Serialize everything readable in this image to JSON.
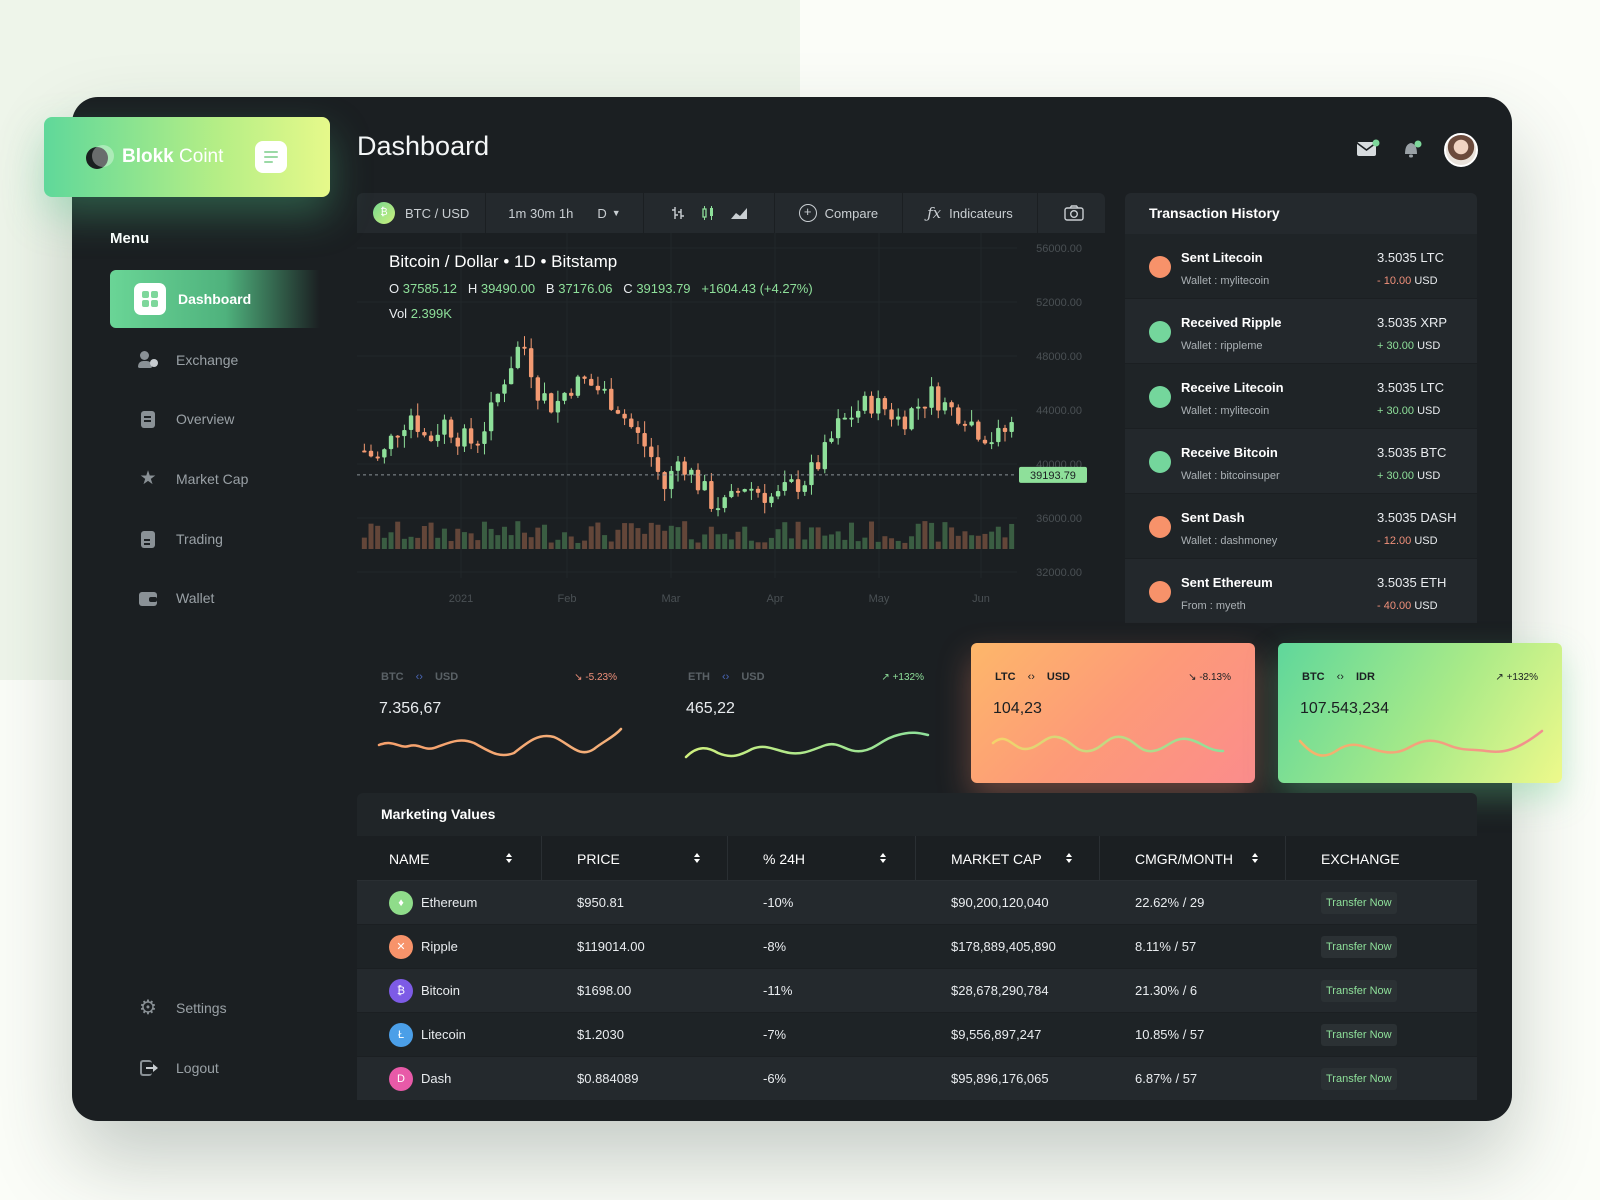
{
  "brand": {
    "name_bold": "Blokk",
    "name_light": "Coint"
  },
  "sidebar": {
    "menu_title": "Menu",
    "items": [
      {
        "label": "Dashboard",
        "icon": "grid-icon",
        "active": true
      },
      {
        "label": "Exchange",
        "icon": "users-icon"
      },
      {
        "label": "Overview",
        "icon": "document-icon"
      },
      {
        "label": "Market Cap",
        "icon": "star-icon"
      },
      {
        "label": "Trading",
        "icon": "file-icon"
      },
      {
        "label": "Wallet",
        "icon": "wallet-icon"
      }
    ],
    "bottom": [
      {
        "label": "Settings",
        "icon": "gear-icon"
      },
      {
        "label": "Logout",
        "icon": "logout-icon"
      }
    ]
  },
  "header": {
    "title": "Dashboard"
  },
  "chart_toolbar": {
    "pair": "BTC / USD",
    "intervals": "1m 30m 1h",
    "period": "D",
    "compare": "Compare",
    "indicators": "Indicateurs"
  },
  "chart": {
    "title": "Bitcoin / Dollar • 1D • Bitstamp",
    "o_label": "O",
    "o_value": "37585.12",
    "h_label": "H",
    "h_value": "39490.00",
    "b_label": "B",
    "b_value": "37176.06",
    "c_label": "C",
    "c_value": "39193.79",
    "change": "+1604.43 (+4.27%)",
    "vol_label": "Vol",
    "vol_value": "2.399K",
    "last_price": "39193.79"
  },
  "chart_data": {
    "type": "candlestick",
    "x_ticks": [
      "2021",
      "Feb",
      "Mar",
      "Apr",
      "May",
      "Jun"
    ],
    "y_ticks": [
      "56000.00",
      "52000.00",
      "48000.00",
      "44000.00",
      "40000.00",
      "36000.00",
      "32000.00"
    ],
    "ylim": [
      32000,
      56000
    ],
    "last_price": 39193.79,
    "close_path": [
      41000,
      40200,
      42500,
      43800,
      41600,
      43200,
      42000,
      41500,
      43700,
      46800,
      49200,
      45500,
      44200,
      45800,
      46100,
      45400,
      44400,
      42500,
      41000,
      38200,
      40500,
      38800,
      37200,
      36900,
      38500,
      38000,
      37400,
      38300,
      38900,
      40400,
      42800,
      43800,
      44600,
      44100,
      43200,
      44300,
      45200,
      44100,
      43700,
      42400,
      41800,
      42900
    ],
    "volume_axis": "none"
  },
  "transactions": {
    "title": "Transaction History",
    "items": [
      {
        "title": "Sent Litecoin",
        "sub": "Wallet : mylitecoin",
        "amount": "3.5035 LTC",
        "usd": "- 10.00 USD",
        "positive": false,
        "color": "#f7926a"
      },
      {
        "title": "Received Ripple",
        "sub": "Wallet : rippleme",
        "amount": "3.5035 XRP",
        "usd": "+ 30.00 USD",
        "positive": true,
        "color": "#74d69c"
      },
      {
        "title": "Receive Litecoin",
        "sub": "Wallet : mylitecoin",
        "amount": "3.5035 LTC",
        "usd": "+ 30.00 USD",
        "positive": true,
        "color": "#74d69c"
      },
      {
        "title": "Receive Bitcoin",
        "sub": "Wallet : bitcoinsuper",
        "amount": "3.5035 BTC",
        "usd": "+ 30.00 USD",
        "positive": true,
        "color": "#74d69c"
      },
      {
        "title": "Sent Dash",
        "sub": "Wallet : dashmoney",
        "amount": "3.5035 DASH",
        "usd": "- 12.00 USD",
        "positive": false,
        "color": "#f7926a"
      },
      {
        "title": "Sent Ethereum",
        "sub": "From : myeth",
        "amount": "3.5035 ETH",
        "usd": "- 40.00 USD",
        "positive": false,
        "color": "#f7926a"
      }
    ]
  },
  "mini_cards": [
    {
      "from": "BTC",
      "to": "USD",
      "change": "-5.23%",
      "value": "7.356,67",
      "style": "dark"
    },
    {
      "from": "ETH",
      "to": "USD",
      "change": "+132%",
      "value": "465,22",
      "style": "dark"
    },
    {
      "from": "LTC",
      "to": "USD",
      "change": "-8.13%",
      "value": "104,23",
      "style": "orange"
    },
    {
      "from": "BTC",
      "to": "IDR",
      "change": "+132%",
      "value": "107.543,234",
      "style": "green"
    }
  ],
  "marketing": {
    "title": "Marketing Values",
    "columns": [
      "NAME",
      "PRICE",
      "% 24H",
      "MARKET CAP",
      "CMGR/MONTH",
      "EXCHANGE"
    ],
    "rows": [
      {
        "name": "Ethereum",
        "price": "$950.81",
        "change": "-10%",
        "cap": "$90,200,120,040",
        "cmgr": "22.62% / 29",
        "action": "Transfer Now",
        "color": "#8fdc8a",
        "glyph": "♦"
      },
      {
        "name": "Ripple",
        "price": "$119014.00",
        "change": "-8%",
        "cap": "$178,889,405,890",
        "cmgr": "8.11% / 57",
        "action": "Transfer Now",
        "color": "#f7936a",
        "glyph": "✕"
      },
      {
        "name": "Bitcoin",
        "price": "$1698.00",
        "change": "-11%",
        "cap": "$28,678,290,784",
        "cmgr": "21.30% / 6",
        "action": "Transfer Now",
        "color": "#7d5be6",
        "glyph": "₿"
      },
      {
        "name": "Litecoin",
        "price": "$1.2030",
        "change": "-7%",
        "cap": "$9,556,897,247",
        "cmgr": "10.85% / 57",
        "action": "Transfer Now",
        "color": "#4b9fe8",
        "glyph": "Ł"
      },
      {
        "name": "Dash",
        "price": "$0.884089",
        "change": "-6%",
        "cap": "$95,896,176,065",
        "cmgr": "6.87% / 57",
        "action": "Transfer Now",
        "color": "#e85aa8",
        "glyph": "D"
      }
    ]
  },
  "colors": {
    "accent_green": "#8ee09a",
    "accent_red": "#f0907a",
    "bg": "#1b1f22"
  }
}
